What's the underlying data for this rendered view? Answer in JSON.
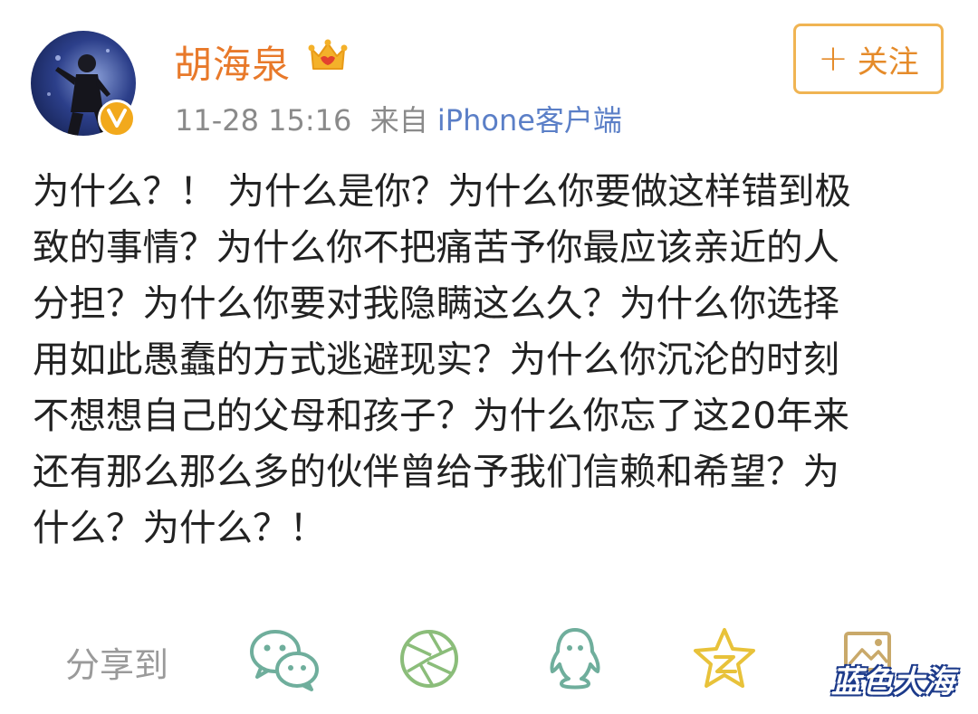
{
  "post": {
    "username": "胡海泉",
    "time": "11-28 15:16",
    "source_prefix": "来自",
    "source": "iPhone客户端",
    "follow_label": "关注",
    "text_lines": [
      "为什么？！ 为什么是你？为什么你要做这样错到极",
      "致的事情？为什么你不把痛苦予你最应该亲近的人",
      "分担？为什么你要对我隐瞒这么久？为什么你选择",
      "用如此愚蠢的方式逃避现实？为什么你沉沦的时刻",
      "不想想自己的父母和孩子？为什么你忘了这20年来",
      "还有那么那么多的伙伴曾给予我们信赖和希望？为",
      "什么？为什么？！"
    ]
  },
  "share": {
    "label": "分享到",
    "targets": [
      "wechat-icon",
      "moments-icon",
      "qq-icon",
      "qzone-icon",
      "photo-icon"
    ]
  },
  "watermark": "蓝色大海",
  "colors": {
    "username": "#e8792a",
    "follow_border": "#f0b453",
    "source_link": "#5b7fc7",
    "share_icons": "#6fae9c"
  }
}
